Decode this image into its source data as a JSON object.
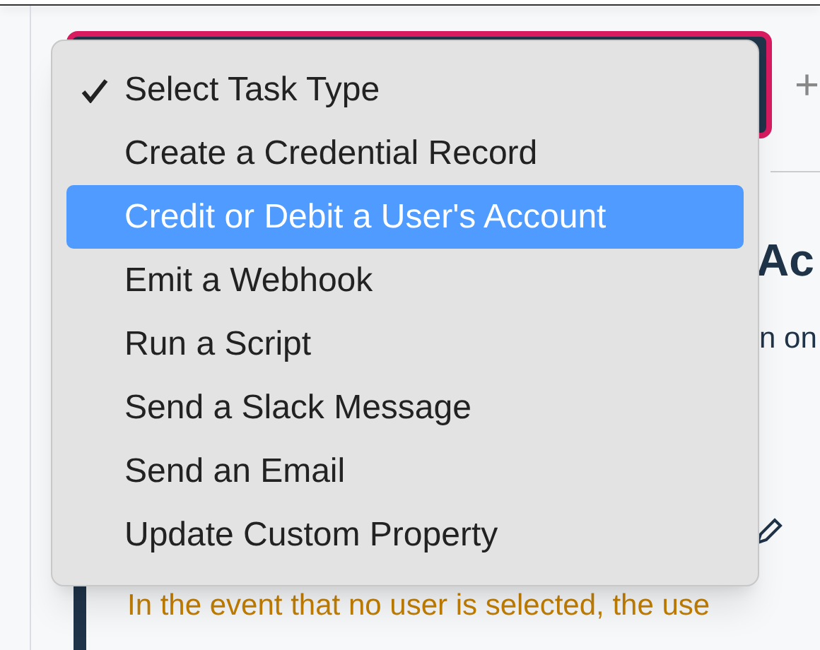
{
  "select_field": {
    "open": true
  },
  "add_icon_text": "+",
  "background": {
    "heading": "Ac",
    "description": "n on",
    "warning": "In the event that no user is selected, the use"
  },
  "menu": {
    "items": [
      {
        "label": "Select Task Type",
        "checked": true,
        "selected": false
      },
      {
        "label": "Create a Credential Record",
        "checked": false,
        "selected": false
      },
      {
        "label": "Credit or Debit a User's Account",
        "checked": false,
        "selected": true
      },
      {
        "label": "Emit a Webhook",
        "checked": false,
        "selected": false
      },
      {
        "label": "Run a Script",
        "checked": false,
        "selected": false
      },
      {
        "label": "Send a Slack Message",
        "checked": false,
        "selected": false
      },
      {
        "label": "Send an Email",
        "checked": false,
        "selected": false
      },
      {
        "label": "Update Custom Property",
        "checked": false,
        "selected": false
      }
    ]
  }
}
